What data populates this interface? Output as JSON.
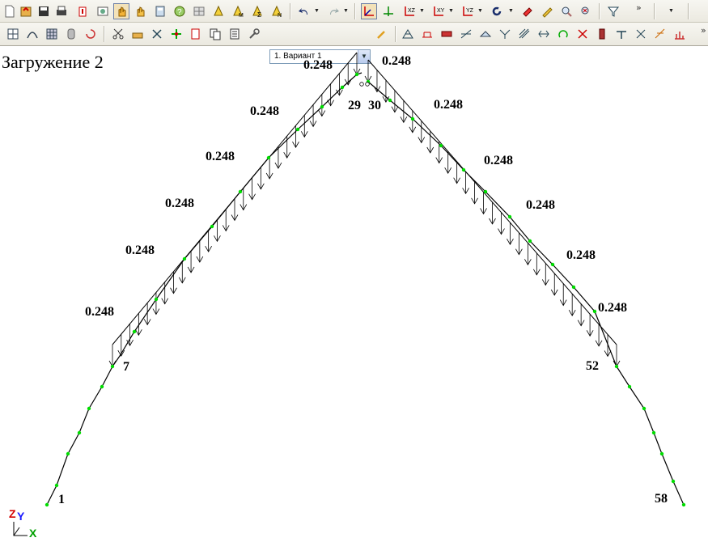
{
  "toolbar": {
    "variant_value": "1. Вариант 1"
  },
  "view": {
    "load_case_title": "Загружение 2"
  },
  "diagram": {
    "load_labels": [
      "0.248",
      "0.248",
      "0.248",
      "0.248",
      "0.248",
      "0.248",
      "0.248",
      "0.248",
      "0.248",
      "0.248",
      "0.248",
      "0.248"
    ],
    "node_labels": [
      "1",
      "7",
      "29",
      "30",
      "52",
      "58"
    ]
  },
  "axes": {
    "z": "Z",
    "y": "Y",
    "x": "X"
  },
  "colors": {
    "node": "#00dd00",
    "axis_z": "#d40000",
    "axis_y": "#1a1aff",
    "axis_x": "#00a000"
  }
}
